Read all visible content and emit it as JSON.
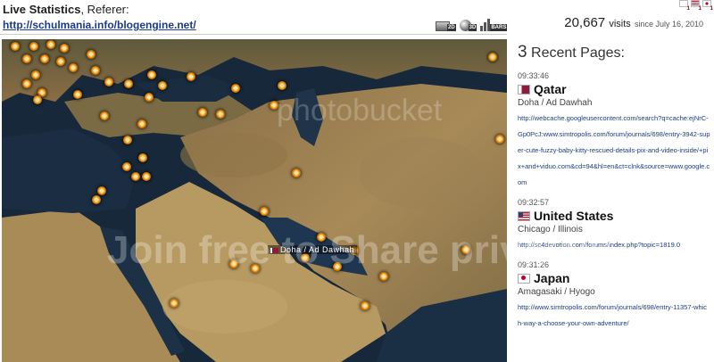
{
  "header": {
    "title_bold": "Live Statistics",
    "title_rest": ", Referer:",
    "referer_url": "http://schulmania.info/blogengine.net/"
  },
  "view_buttons": [
    "2D",
    "3D",
    "BARS"
  ],
  "top_flags": [
    {
      "icon": "mini-flag-icon",
      "count": "1"
    },
    {
      "icon": "us-flag-icon",
      "count": "1"
    },
    {
      "icon": "japan-flag-icon",
      "count": "1"
    }
  ],
  "visits": {
    "count": "20,667",
    "label": "visits",
    "since": "since July 16, 2010"
  },
  "map": {
    "label": "Doha / Ad Dawhah",
    "accent_color": "#d77800"
  },
  "recent": {
    "count": "3",
    "title": "Recent Pages:",
    "items": [
      {
        "time": "09:33:46",
        "country": "Qatar",
        "flag": "qatar-flag-icon",
        "city": "Doha / Ad Dawhah",
        "url": "http://webcache.googleusercontent.com/search?q=cache:ejNrC-Gp0PcJ:www.simtropolis.com/forum/journals/698/entry-3942-super-cute-fuzzy-baby-kitty-rescued-details-pix-and-video-inside/+pix+and+viduo.com&cd=94&hl=en&ct=clnk&source=www.google.com"
      },
      {
        "time": "09:32:57",
        "country": "United States",
        "flag": "us-flag-icon",
        "city": "Chicago / Illinois",
        "url": "http://sc4devotion.com/forums/index.php?topic=1819.0"
      },
      {
        "time": "09:31:26",
        "country": "Japan",
        "flag": "japan-flag-icon",
        "city": "Amagasaki / Hyogo",
        "url": "http://www.simtropolis.com/forum/journals/698/entry-11357-which-way-a-choose-your-own-adventure/"
      }
    ]
  },
  "watermark": {
    "big": "Join free to Share privately",
    "small": "photobucket"
  }
}
